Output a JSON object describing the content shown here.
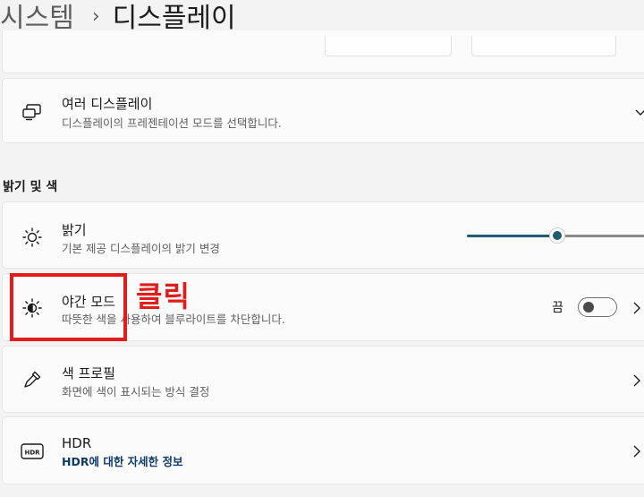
{
  "breadcrumb": {
    "parent": "시스템",
    "separator": "›",
    "current": "디스플레이"
  },
  "rows": {
    "multi_display": {
      "title": "여러 디스플레이",
      "subtitle": "디스플레이의 프레젠테이션 모드를 선택합니다."
    },
    "brightness": {
      "title": "밝기",
      "subtitle": "기본 제공 디스플레이의 밝기 변경",
      "level_fraction": 0.48
    },
    "night_mode": {
      "title": "야간 모드",
      "subtitle": "따뜻한 색을 사용하여 블루라이트를 차단합니다.",
      "state_label": "끔",
      "enabled": false
    },
    "color_profile": {
      "title": "색 프로필",
      "subtitle": "화면에 색이 표시되는 방식 결정"
    },
    "hdr": {
      "title": "HDR",
      "link": "HDR에 대한 자세한 정보"
    }
  },
  "section": {
    "brightness_color": "밝기 및 색"
  },
  "annotation": {
    "text": "클릭",
    "color": "#e21b1b"
  },
  "colors": {
    "accent": "#1f5d6e",
    "link": "#0f3a68"
  },
  "icons": [
    "multi-display-icon",
    "brightness-icon",
    "night-mode-icon",
    "eyedropper-icon",
    "hdr-icon",
    "chevron-right-icon",
    "chevron-down-icon"
  ]
}
